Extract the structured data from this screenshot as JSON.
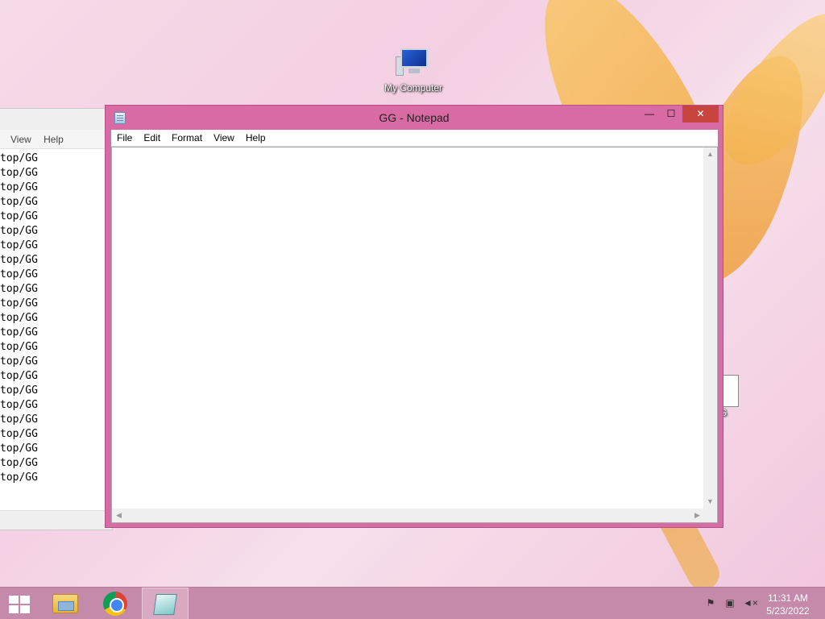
{
  "desktop": {
    "icons": [
      {
        "label": "My Computer"
      },
      {
        "label": "G"
      }
    ]
  },
  "background_window": {
    "menu": [
      "View",
      "Help"
    ],
    "lines": [
      "top/GG",
      "top/GG",
      "top/GG",
      "top/GG",
      "top/GG",
      "top/GG",
      "top/GG",
      "top/GG",
      "top/GG",
      "top/GG",
      "top/GG",
      "top/GG",
      "top/GG",
      "top/GG",
      "top/GG",
      "top/GG",
      "top/GG",
      "top/GG",
      "top/GG",
      "top/GG",
      "top/GG",
      "top/GG",
      "top/GG"
    ]
  },
  "notepad": {
    "title": "GG - Notepad",
    "controls": {
      "minimize": "—",
      "maximize": "☐",
      "close": "✕"
    },
    "menu": [
      "File",
      "Edit",
      "Format",
      "View",
      "Help"
    ],
    "content": ""
  },
  "taskbar": {
    "apps": [
      "start-icon",
      "file-explorer-icon",
      "chrome-icon",
      "notepad-icon"
    ],
    "tray": {
      "time": "11:31 AM",
      "date": "5/23/2022"
    }
  }
}
